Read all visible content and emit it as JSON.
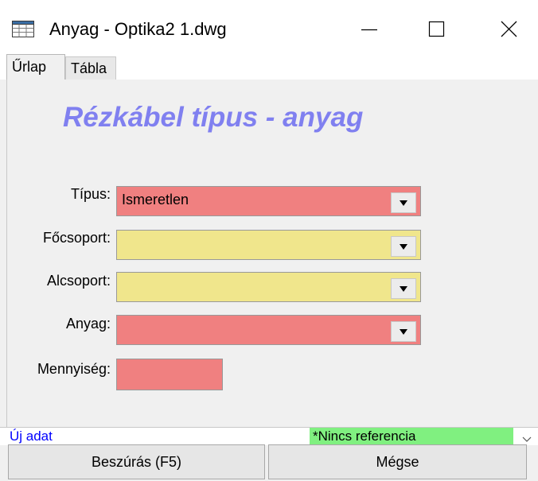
{
  "window": {
    "title": "Anyag - Optika2 1.dwg",
    "icon": "table-icon",
    "controls": [
      "minimize-icon",
      "maximize-icon",
      "close-icon"
    ]
  },
  "tabs": [
    {
      "label": "Űrlap",
      "active": true
    },
    {
      "label": "Tábla",
      "active": false
    }
  ],
  "form": {
    "title": "Rézkábel típus - anyag",
    "fields": {
      "tipus": {
        "label": "Típus:",
        "value": "Ismeretlen",
        "color": "#f08080"
      },
      "focsoport": {
        "label": "Főcsoport:",
        "value": "",
        "color": "#f0e68c"
      },
      "alcsoport": {
        "label": "Alcsoport:",
        "value": "",
        "color": "#f0e68c"
      },
      "anyag": {
        "label": "Anyag:",
        "value": "",
        "color": "#f08080"
      },
      "mennyiseg": {
        "label": "Mennyiség:",
        "value": "",
        "color": "#f08080"
      }
    }
  },
  "status": {
    "left": "Új adat",
    "reference": "*Nincs referencia",
    "reference_color": "#80f080"
  },
  "buttons": {
    "insert": "Beszúrás (F5)",
    "cancel": "Mégse"
  }
}
